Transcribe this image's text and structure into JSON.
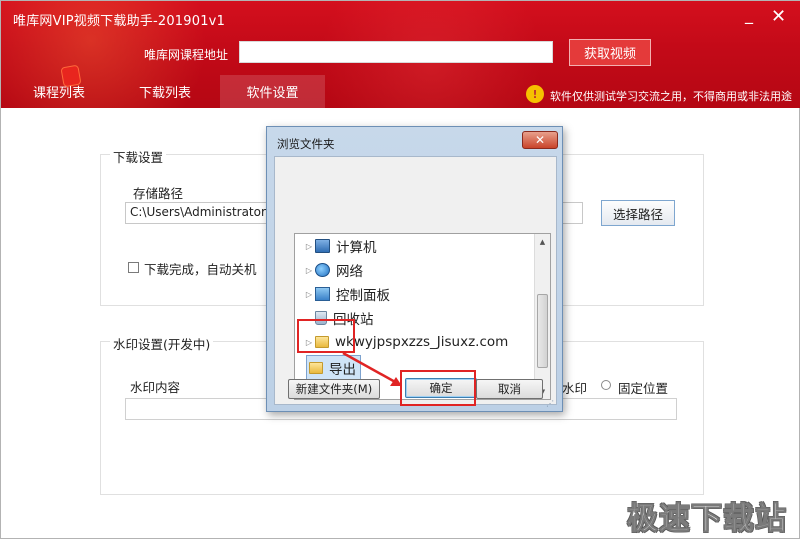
{
  "window": {
    "title": "唯库网VIP视频下载助手-201901v1",
    "minimize_label": "_",
    "close_label": "✕"
  },
  "header": {
    "url_label": "唯库网课程地址",
    "url_value": "",
    "get_button": "获取视频",
    "tabs": [
      {
        "label": "课程列表"
      },
      {
        "label": "下载列表"
      },
      {
        "label": "软件设置"
      }
    ],
    "active_tab": "软件设置",
    "notice_icon": "!",
    "notice": "软件仅供测试学习交流之用，不得商用或非法用途"
  },
  "download_settings": {
    "legend": "下载设置",
    "storage_label": "存储路径",
    "storage_path": "C:\\Users\\Administrator\\",
    "choose_button": "选择路径",
    "shutdown_label": "下载完成，自动关机",
    "shutdown_checked": false
  },
  "watermark_settings": {
    "legend": "水印设置(开发中)",
    "content_label": "水印内容",
    "content_value": "",
    "option_partial": "水印",
    "fixed_position_label": "固定位置",
    "fixed_position_selected": false
  },
  "dialog": {
    "title": "浏览文件夹",
    "close_label": "✕",
    "items": [
      {
        "label": "计算机",
        "icon": "computer-icon"
      },
      {
        "label": "网络",
        "icon": "network-icon"
      },
      {
        "label": "控制面板",
        "icon": "control-panel-icon"
      },
      {
        "label": "回收站",
        "icon": "recycle-bin-icon"
      },
      {
        "label": "wkwyjpspxzzs_Jisuxz.com",
        "icon": "folder-icon"
      },
      {
        "label": "导出",
        "icon": "folder-icon",
        "selected": true
      }
    ],
    "new_folder_button": "新建文件夹(M)",
    "ok_button": "确定",
    "cancel_button": "取消"
  },
  "site_watermark": "极速下载站"
}
